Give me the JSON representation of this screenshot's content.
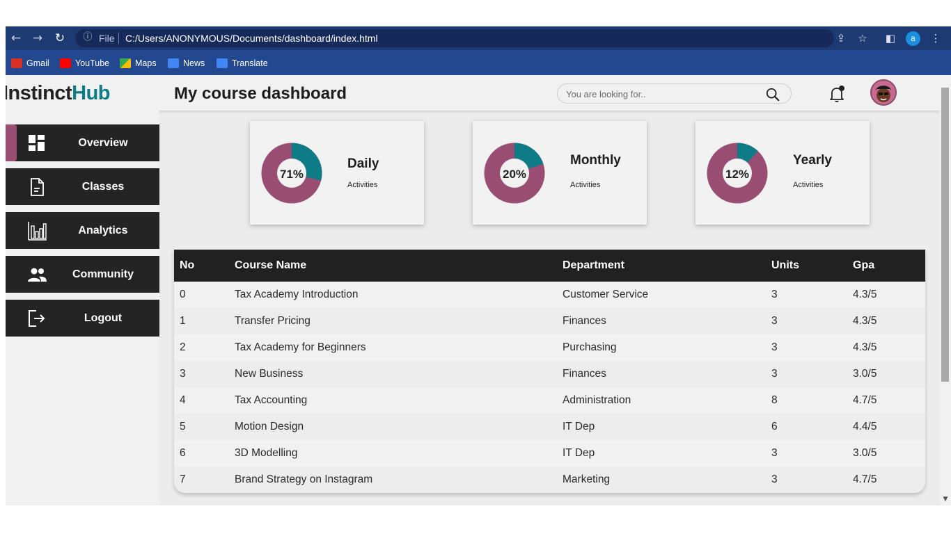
{
  "browser": {
    "url_scheme": "File",
    "url": "C:/Users/ANONYMOUS/Documents/dashboard/index.html",
    "profile_initial": "a",
    "bookmarks": [
      {
        "label": "Gmail",
        "color": "#d93025"
      },
      {
        "label": "YouTube",
        "color": "#ff0000"
      },
      {
        "label": "Maps",
        "color": "#34a853"
      },
      {
        "label": "News",
        "color": "#4285f4"
      },
      {
        "label": "Translate",
        "color": "#4285f4"
      }
    ]
  },
  "header": {
    "logo_first": "Instinct",
    "logo_second": "Hub",
    "title": "My course dashboard",
    "search_placeholder": "You are looking for.."
  },
  "sidebar": {
    "items": [
      {
        "label": "Overview",
        "icon": "dashboard-icon",
        "active": true
      },
      {
        "label": "Classes",
        "icon": "document-icon",
        "active": false
      },
      {
        "label": "Analytics",
        "icon": "bar-chart-icon",
        "active": false
      },
      {
        "label": "Community",
        "icon": "people-icon",
        "active": false
      },
      {
        "label": "Logout",
        "icon": "logout-icon",
        "active": false
      }
    ]
  },
  "cards": [
    {
      "title": "Daily",
      "subtitle": "Activities",
      "percent_label": "71%",
      "teal_fraction": 0.29
    },
    {
      "title": "Monthly",
      "subtitle": "Activities",
      "percent_label": "20%",
      "teal_fraction": 0.2
    },
    {
      "title": "Yearly",
      "subtitle": "Activities",
      "percent_label": "12%",
      "teal_fraction": 0.12
    }
  ],
  "colors": {
    "accent_teal": "#0e7c86",
    "accent_plum": "#9a4d73",
    "dark": "#242424"
  },
  "table": {
    "headers": [
      "No",
      "Course Name",
      "Department",
      "Units",
      "Gpa"
    ],
    "rows": [
      [
        "0",
        "Tax Academy Introduction",
        "Customer Service",
        "3",
        "4.3/5"
      ],
      [
        "1",
        "Transfer Pricing",
        "Finances",
        "3",
        "4.3/5"
      ],
      [
        "2",
        "Tax Academy for Beginners",
        "Purchasing",
        "3",
        "4.3/5"
      ],
      [
        "3",
        "New Business",
        "Finances",
        "3",
        "3.0/5"
      ],
      [
        "4",
        "Tax Accounting",
        "Administration",
        "8",
        "4.7/5"
      ],
      [
        "5",
        "Motion Design",
        "IT Dep",
        "6",
        "4.4/5"
      ],
      [
        "6",
        "3D Modelling",
        "IT Dep",
        "3",
        "3.0/5"
      ],
      [
        "7",
        "Brand Strategy on Instagram",
        "Marketing",
        "3",
        "4.7/5"
      ]
    ]
  }
}
